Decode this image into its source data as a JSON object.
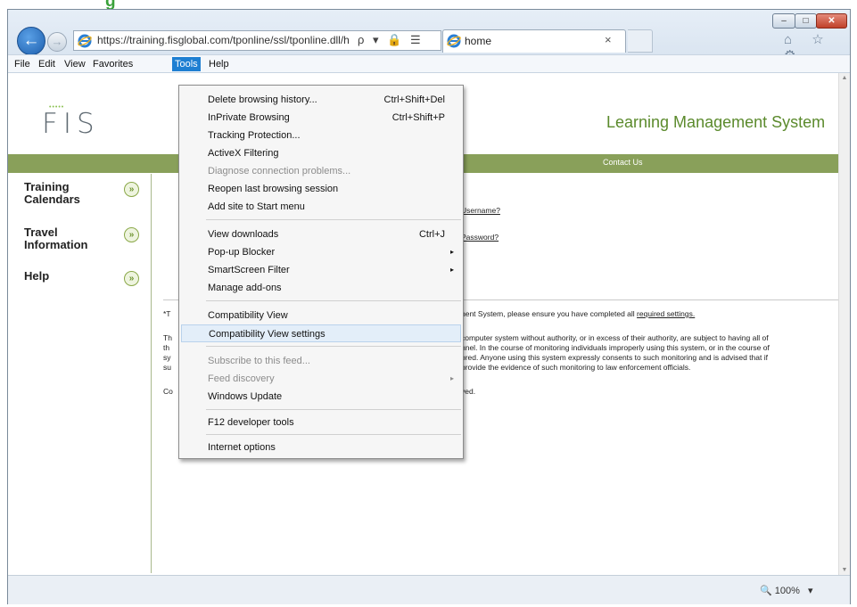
{
  "top_heading": "g",
  "window": {
    "minimize": "–",
    "maximize": "□",
    "close": "✕"
  },
  "nav": {
    "back_glyph": "←",
    "forward_glyph": "→",
    "address": "https://training.fisglobal.com/tponline/ssl/tponline.dll/h",
    "address_tools": "ρ ▾ 🔒 ☰ ↻ ✕"
  },
  "tab": {
    "title": "home",
    "close": "×"
  },
  "right_icons": "⌂ ☆ ⚙",
  "menubar": [
    "File",
    "Edit",
    "View",
    "Favorites",
    "Tools",
    "Help"
  ],
  "page": {
    "logo_text": "FIS",
    "logo_dots": "•••••",
    "lms_title": "Learning Management System",
    "contact": "Contact Us",
    "sidebar": [
      {
        "label": "Training\nCalendars",
        "icon": "double-chevron-down-icon"
      },
      {
        "label": "Travel\nInformation",
        "icon": "double-chevron-down-icon"
      },
      {
        "label": "Help",
        "icon": "double-chevron-down-icon"
      }
    ],
    "sidebar_chevron": "»",
    "forgot_username": "Username?",
    "forgot_password": "Password?",
    "notice_left": "*T",
    "notice_right_prefix": "nent System, please ensure you have completed all ",
    "notice_right_link": "required settings.",
    "para_left": [
      "Th",
      "th",
      "sy",
      "su"
    ],
    "para_right": [
      "computer system without authority, or in excess of their authority, are subject to having all of",
      "nnel. In the course of monitoring individuals improperly using this system, or in the course of",
      "ored. Anyone using this system expressly consents to such monitoring and is advised that if",
      "provide the evidence of such monitoring to law enforcement officials."
    ],
    "copyright_left": "Co",
    "copyright_right": "ved."
  },
  "tools_menu": [
    {
      "label": "Delete browsing history...",
      "shortcut": "Ctrl+Shift+Del"
    },
    {
      "label": "InPrivate Browsing",
      "shortcut": "Ctrl+Shift+P"
    },
    {
      "label": "Tracking Protection...",
      "shortcut": ""
    },
    {
      "label": "ActiveX Filtering",
      "shortcut": ""
    },
    {
      "label": "Diagnose connection problems...",
      "shortcut": "",
      "disabled": true
    },
    {
      "label": "Reopen last browsing session",
      "shortcut": ""
    },
    {
      "label": "Add site to Start menu",
      "shortcut": ""
    },
    {
      "label": "View downloads",
      "shortcut": "Ctrl+J"
    },
    {
      "label": "Pop-up Blocker",
      "shortcut": "",
      "submenu": true
    },
    {
      "label": "SmartScreen Filter",
      "shortcut": "",
      "submenu": true
    },
    {
      "label": "Manage add-ons",
      "shortcut": ""
    },
    {
      "label": "Compatibility View",
      "shortcut": ""
    },
    {
      "label": "Compatibility View settings",
      "shortcut": "",
      "highlighted": true
    },
    {
      "label": "Subscribe to this feed...",
      "shortcut": "",
      "disabled": true
    },
    {
      "label": "Feed discovery",
      "shortcut": "",
      "disabled": true,
      "submenu": true
    },
    {
      "label": "Windows Update",
      "shortcut": ""
    },
    {
      "label": "F12 developer tools",
      "shortcut": ""
    },
    {
      "label": "Internet options",
      "shortcut": ""
    }
  ],
  "submenu_arrow": "▸",
  "status": {
    "zoom": "100%",
    "zoom_icon": "🔍",
    "zoom_caret": "▾"
  },
  "colors": {
    "accent": "#1e7fd2",
    "brand_green": "#89a05a",
    "title_green": "#5b8a2c"
  }
}
